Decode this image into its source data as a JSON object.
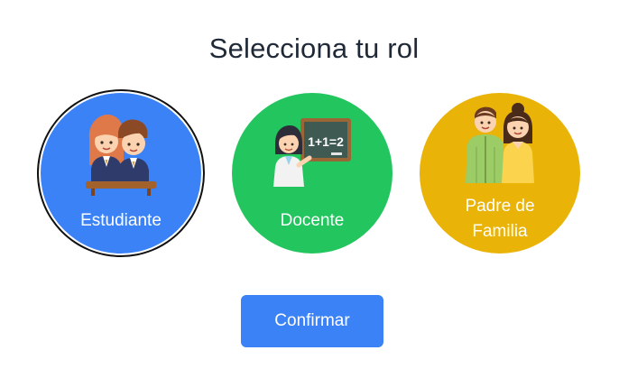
{
  "header": {
    "title": "Selecciona tu rol"
  },
  "roles": [
    {
      "key": "student",
      "label": "Estudiante",
      "color": "#3b82f6",
      "icon": "students-icon",
      "selected": true
    },
    {
      "key": "teacher",
      "label": "Docente",
      "color": "#22c55e",
      "icon": "teacher-blackboard-icon",
      "selected": false,
      "board_text": "1+1=2"
    },
    {
      "key": "parent",
      "label_line1": "Padre de",
      "label_line2": "Familia",
      "color": "#eab308",
      "icon": "parents-icon",
      "selected": false
    }
  ],
  "actions": {
    "confirm_label": "Confirmar",
    "confirm_color": "#3b82f6"
  }
}
